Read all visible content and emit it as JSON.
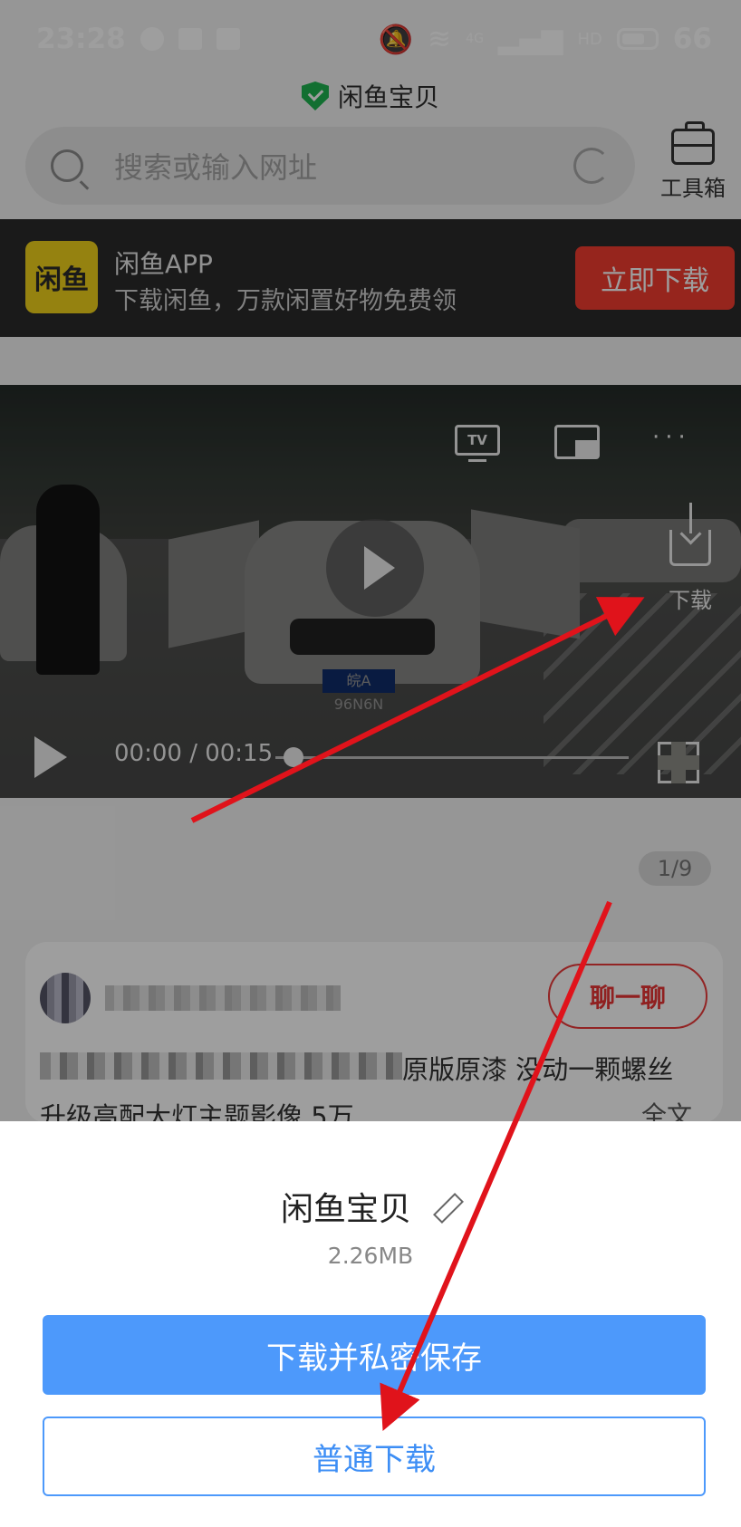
{
  "status_bar": {
    "time": "23:28",
    "network": "4G",
    "hd": "HD",
    "battery": "66"
  },
  "header": {
    "title": "闲鱼宝贝"
  },
  "search": {
    "placeholder": "搜索或输入网址",
    "toolbox_label": "工具箱"
  },
  "banner": {
    "logo_text": "闲鱼",
    "app_name": "闲鱼APP",
    "subtitle": "下载闲鱼，万款闲置好物免费领",
    "download_label": "立即下载"
  },
  "video": {
    "tv_label": "TV",
    "more_label": "···",
    "download_label": "下载",
    "plate": "皖A 96N6N",
    "time": "00:00 / 00:15",
    "progress": 0.05
  },
  "page_indicator": "1/9",
  "post": {
    "chat_label": "聊一聊",
    "desc_visible": "原版原漆 没动一颗螺丝",
    "desc_line2": "升级高配大灯主题影像 5万",
    "full_text": "全文"
  },
  "sheet": {
    "file_name": "闲鱼宝贝",
    "file_size": "2.26MB",
    "private_download_label": "下载并私密保存",
    "normal_download_label": "普通下载"
  },
  "annotation_color": "#e0131b"
}
